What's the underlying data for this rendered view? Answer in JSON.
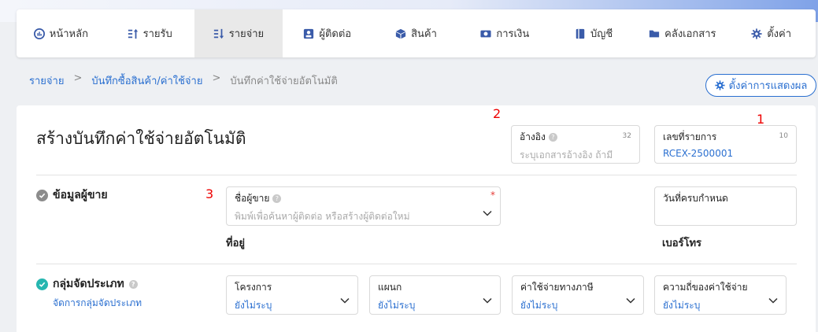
{
  "nav": [
    {
      "label": "หน้าหลัก",
      "icon": "dashboard-icon"
    },
    {
      "label": "รายรับ",
      "icon": "income-icon"
    },
    {
      "label": "รายจ่าย",
      "icon": "expense-icon",
      "active": true
    },
    {
      "label": "ผู้ติดต่อ",
      "icon": "contacts-icon"
    },
    {
      "label": "สินค้า",
      "icon": "box-icon"
    },
    {
      "label": "การเงิน",
      "icon": "money-icon"
    },
    {
      "label": "บัญชี",
      "icon": "ledger-icon"
    },
    {
      "label": "คลังเอกสาร",
      "icon": "folder-icon"
    },
    {
      "label": "ตั้งค่า",
      "icon": "gear-icon"
    }
  ],
  "breadcrumb": {
    "item1": "รายจ่าย",
    "sep": ">",
    "item2": "บันทึกซื้อสินค้า/ค่าใช้จ่าย",
    "item3": "บันทึกค่าใช้จ่ายอัตโนมัติ"
  },
  "display_settings_label": "ตั้งค่าการแสดงผล",
  "page_title": "สร้างบันทึกค่าใช้จ่ายอัตโนมัติ",
  "reference": {
    "label": "อ้างอิง",
    "placeholder": "ระบุเอกสารอ้างอิง ถ้ามี",
    "counter": "32"
  },
  "doc_number": {
    "label": "เลขที่รายการ",
    "value": "RCEX-2500001",
    "counter": "10"
  },
  "vendor_section": {
    "title": "ข้อมูลผู้ขาย"
  },
  "vendor_name": {
    "label": "ชื่อผู้ขาย",
    "placeholder": "พิมพ์เพื่อค้นหาผู้ติดต่อ หรือสร้างผู้ติดต่อใหม่",
    "required_mark": "*"
  },
  "due_date": {
    "label": "วันที่ครบกำหนด"
  },
  "address_label": "ที่อยู่",
  "phone_label": "เบอร์โทร",
  "category_section": {
    "title": "กลุ่มจัดประเภท",
    "manage_link": "จัดการกลุ่มจัดประเภท"
  },
  "category_fields": [
    {
      "label": "โครงการ",
      "value": "ยังไม่ระบุ"
    },
    {
      "label": "แผนก",
      "value": "ยังไม่ระบุ"
    },
    {
      "label": "ค่าใช้จ่ายทางภาษี",
      "value": "ยังไม่ระบุ"
    },
    {
      "label": "ความถี่ของค่าใช้จ่าย",
      "value": "ยังไม่ระบุ"
    }
  ],
  "annotations": {
    "a1": "1",
    "a2": "2",
    "a3": "3"
  },
  "colors": {
    "accent": "#2a6fd0",
    "nav_icon": "#3a5ba9",
    "check_gray": "#8c8c8c",
    "check_teal": "#26b6b0",
    "annotation": "#e00000"
  }
}
